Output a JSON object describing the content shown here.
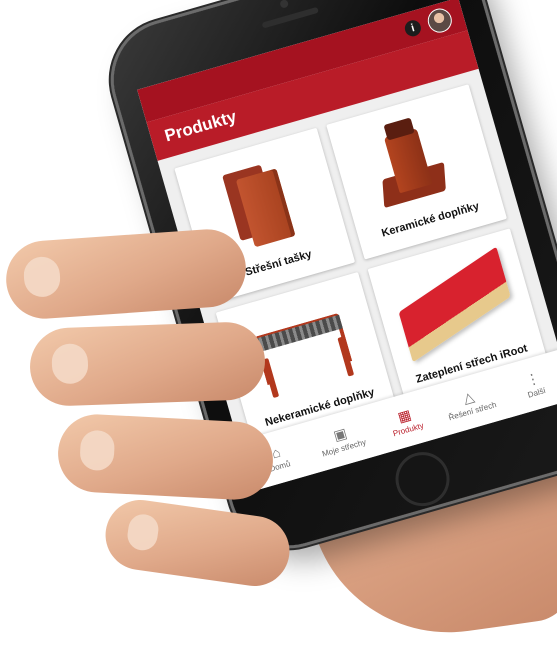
{
  "app": {
    "header_title": "Produkty"
  },
  "status_icons": {
    "info": "i"
  },
  "products": [
    {
      "label": "Střešní tašky",
      "icon": "roof-tile"
    },
    {
      "label": "Keramické doplňky",
      "icon": "ceramic-vent"
    },
    {
      "label": "Nekeramické doplňky",
      "icon": "roof-ladder"
    },
    {
      "label": "Zateplení střech iRoot",
      "icon": "insulation-board"
    }
  ],
  "nav": [
    {
      "label": "Domů",
      "icon": "home-icon",
      "glyph": "⌂"
    },
    {
      "label": "Moje střechy",
      "icon": "image-icon",
      "glyph": "▣"
    },
    {
      "label": "Produkty",
      "icon": "grid-icon",
      "glyph": "▦",
      "active": true
    },
    {
      "label": "Řešení střech",
      "icon": "triangle-icon",
      "glyph": "△"
    },
    {
      "label": "Další",
      "icon": "more-icon",
      "glyph": "⋮"
    }
  ],
  "colors": {
    "brand_red": "#b91c28",
    "status_bar_red": "#a51220"
  }
}
